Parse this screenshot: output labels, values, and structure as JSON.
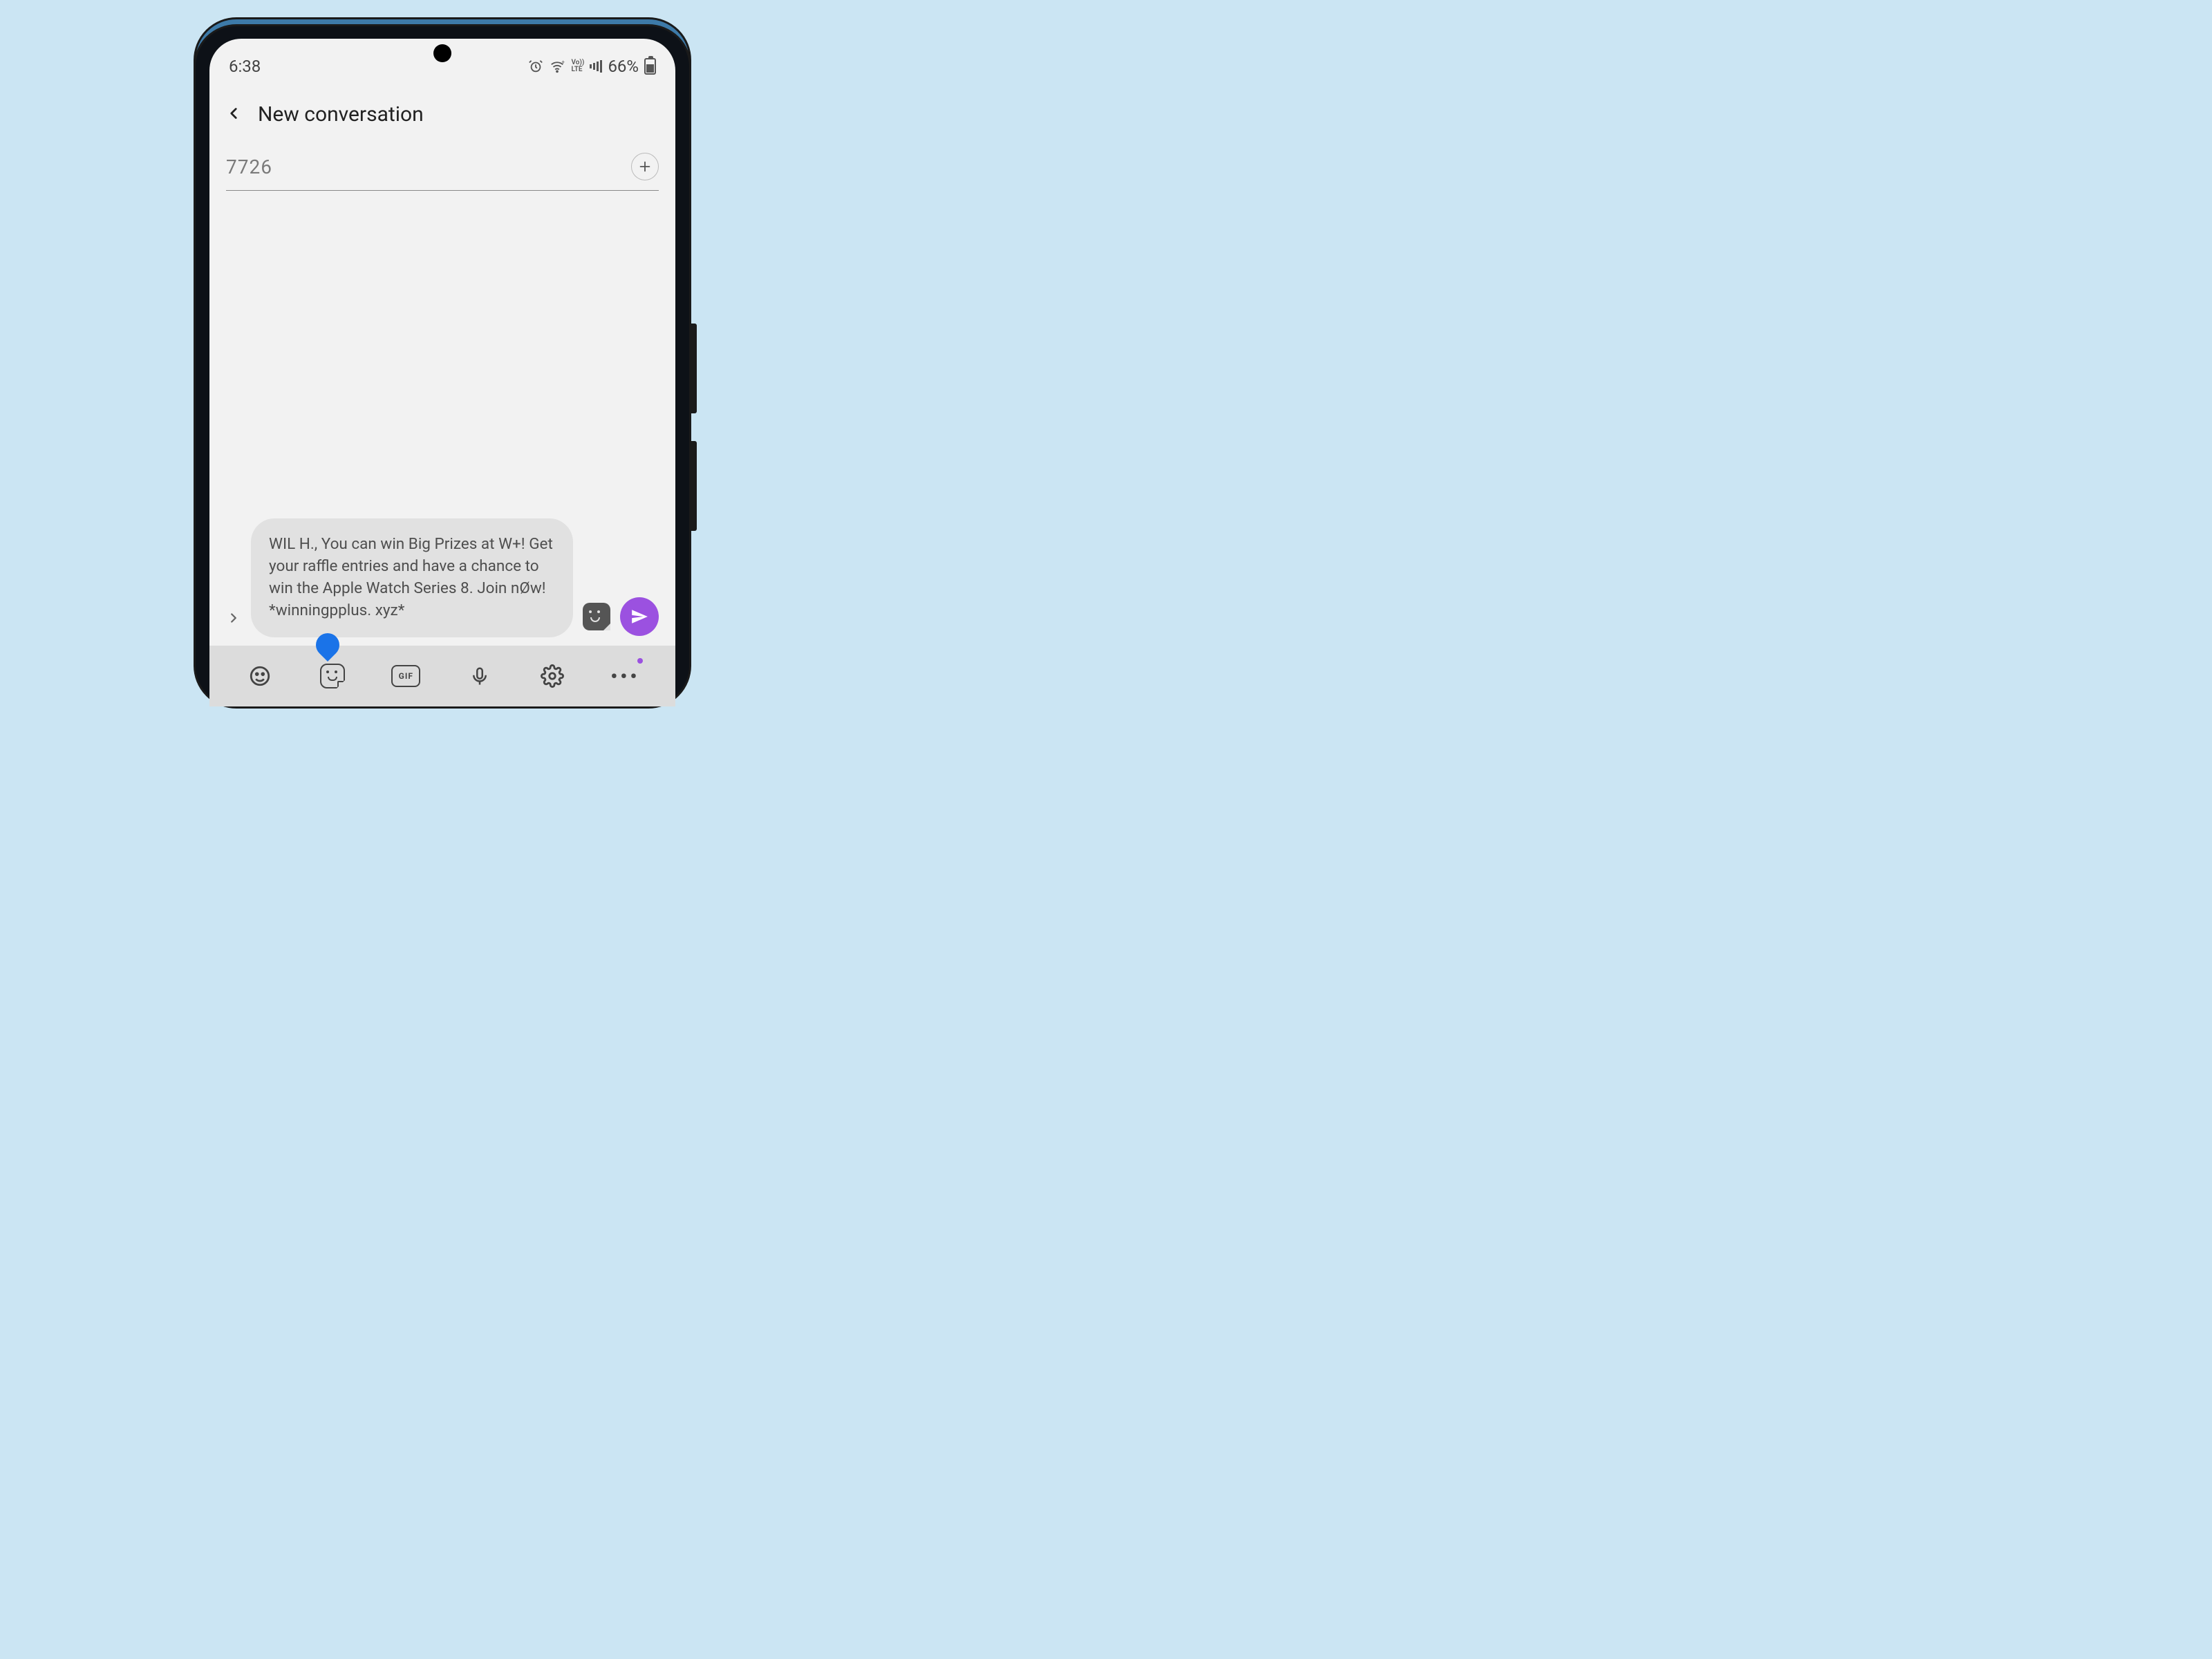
{
  "statusbar": {
    "time": "6:38",
    "volte": "Vo))\nLTE",
    "battery_text": "66%"
  },
  "header": {
    "title": "New conversation"
  },
  "recipient": {
    "value": "7726"
  },
  "compose": {
    "message_text": "WIL H., You can win Big Prizes at W+! Get your raffle entries and have a chance to win the Apple Watch Series 8. Join nØw! *winningpplus. xyz*"
  },
  "keyboard_toolbar": {
    "gif_label": "GIF"
  }
}
